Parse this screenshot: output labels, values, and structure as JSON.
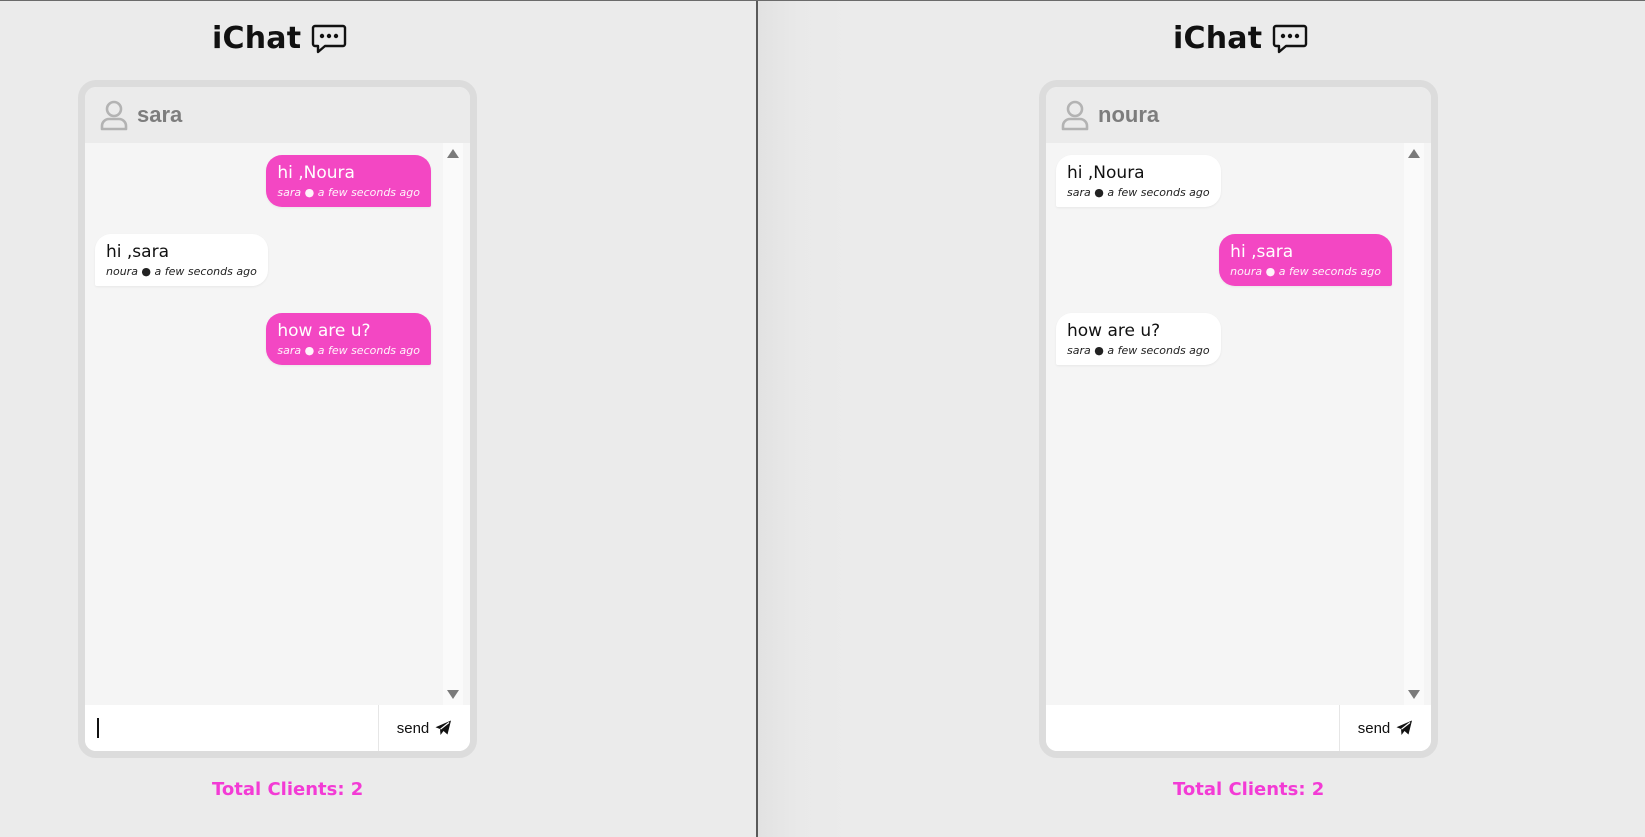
{
  "app": {
    "title": "iChat",
    "accent_color": "#f347c3",
    "clients_color": "#f33bd5"
  },
  "panes": [
    {
      "header": {
        "username": "sara",
        "icon": "user-icon"
      },
      "messages": [
        {
          "text": "hi ,Noura",
          "sender": "sara",
          "time": "a few seconds ago",
          "mine": true
        },
        {
          "text": "hi ,sara",
          "sender": "noura",
          "time": "a few seconds ago",
          "mine": false
        },
        {
          "text": "how are u?",
          "sender": "sara",
          "time": "a few seconds ago",
          "mine": true
        }
      ],
      "composer": {
        "input_value": "",
        "input_placeholder": "",
        "send_label": "send"
      },
      "footer": {
        "total_clients": "Total Clients: 2"
      }
    },
    {
      "header": {
        "username": "noura",
        "icon": "user-icon"
      },
      "messages": [
        {
          "text": "hi ,Noura",
          "sender": "sara",
          "time": "a few seconds ago",
          "mine": false
        },
        {
          "text": "hi ,sara",
          "sender": "noura",
          "time": "a few seconds ago",
          "mine": true
        },
        {
          "text": "how are u?",
          "sender": "sara",
          "time": "a few seconds ago",
          "mine": false
        }
      ],
      "composer": {
        "input_value": "",
        "input_placeholder": "",
        "send_label": "send"
      },
      "footer": {
        "total_clients": "Total Clients: 2"
      }
    }
  ]
}
